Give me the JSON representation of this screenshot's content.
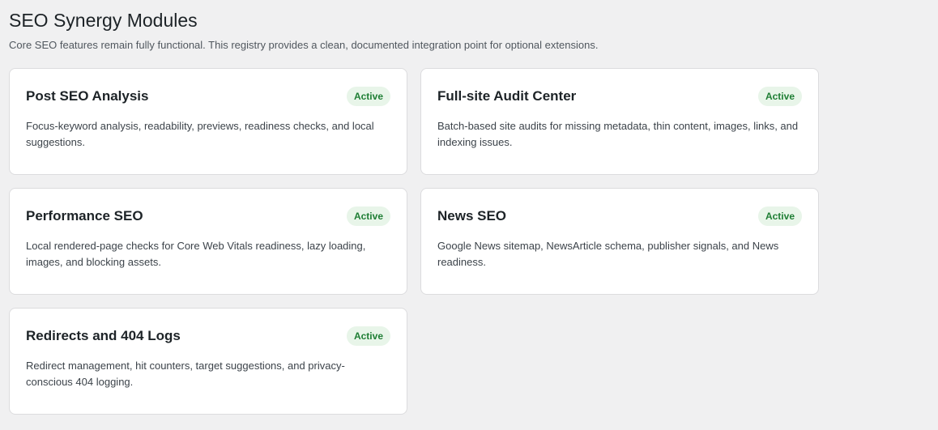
{
  "page": {
    "title": "SEO Synergy Modules",
    "description": "Core SEO features remain fully functional. This registry provides a clean, documented integration point for optional extensions."
  },
  "modules": [
    {
      "title": "Post SEO Analysis",
      "status": "Active",
      "description": "Focus-keyword analysis, readability, previews, readiness checks, and local suggestions."
    },
    {
      "title": "Full-site Audit Center",
      "status": "Active",
      "description": "Batch-based site audits for missing metadata, thin content, images, links, and indexing issues."
    },
    {
      "title": "Performance SEO",
      "status": "Active",
      "description": "Local rendered-page checks for Core Web Vitals readiness, lazy loading, images, and blocking assets."
    },
    {
      "title": "News SEO",
      "status": "Active",
      "description": "Google News sitemap, NewsArticle schema, publisher signals, and News readiness."
    },
    {
      "title": "Redirects and 404 Logs",
      "status": "Active",
      "description": "Redirect management, hit counters, target suggestions, and privacy-conscious 404 logging."
    }
  ],
  "colors": {
    "background": "#f0f0f1",
    "card": "#ffffff",
    "badge_bg": "#e8f5e9",
    "badge_text": "#1e7e34"
  }
}
